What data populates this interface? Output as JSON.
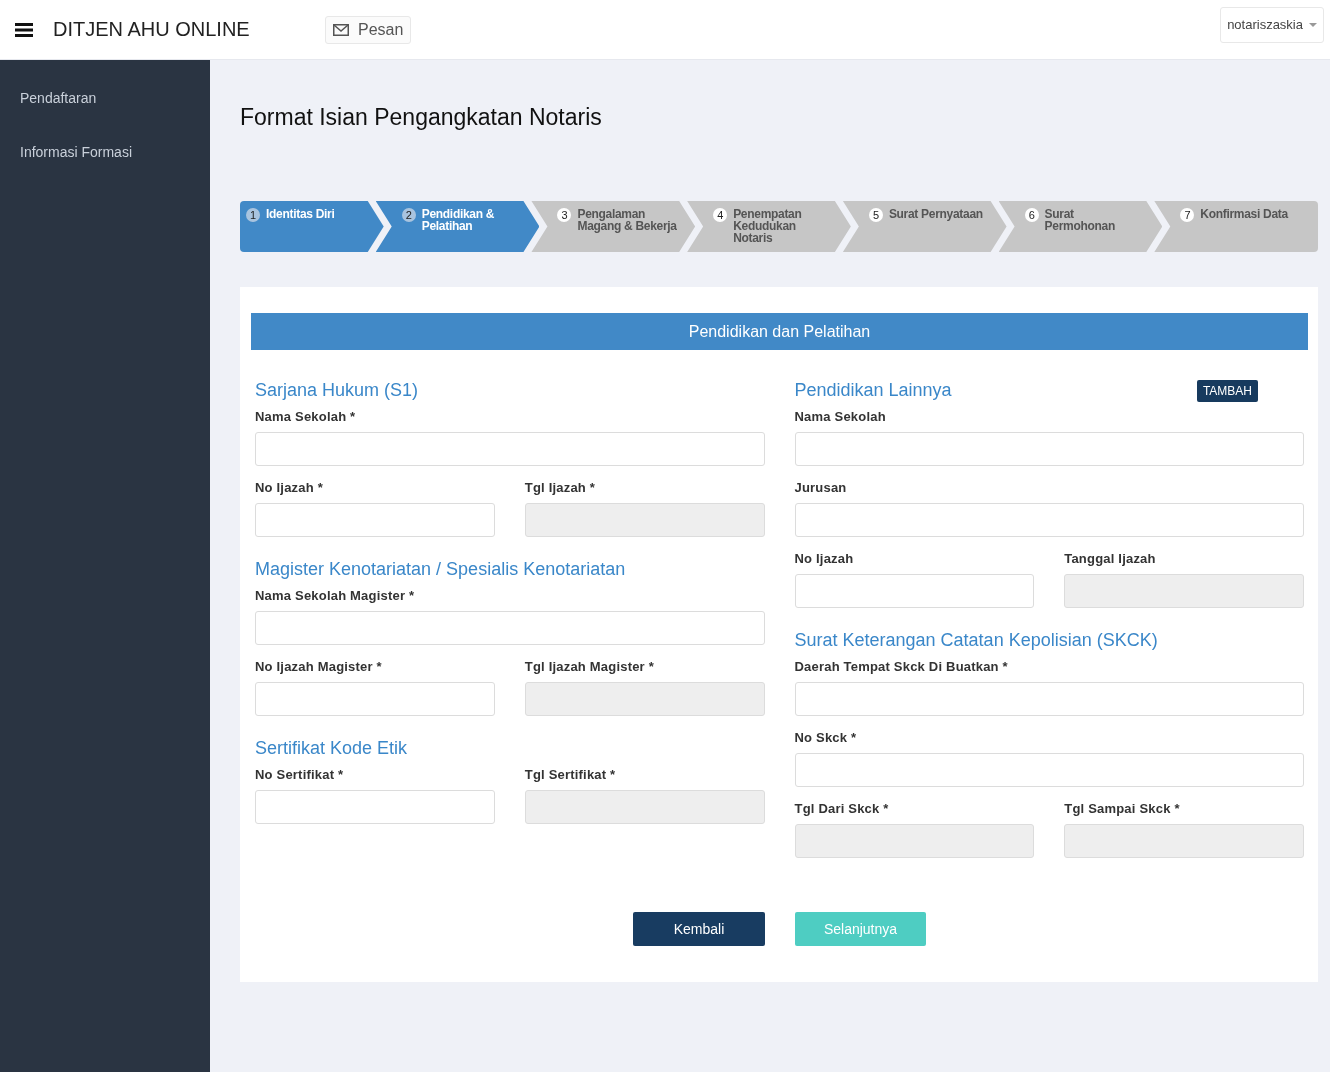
{
  "header": {
    "title": "DITJEN AHU ONLINE",
    "message_button": "Pesan",
    "user_menu": "notariszaskia"
  },
  "sidebar": {
    "items": [
      {
        "label": "Pendaftaran"
      },
      {
        "label": "Informasi Formasi"
      }
    ]
  },
  "page_title": "Format Isian Pengangkatan Notaris",
  "steps": [
    {
      "number": "1",
      "label": "Identitas Diri",
      "active": true
    },
    {
      "number": "2",
      "label": "Pendidikan & Pelatihan",
      "active": true
    },
    {
      "number": "3",
      "label": "Pengalaman Magang & Bekerja",
      "active": false
    },
    {
      "number": "4",
      "label": "Penempatan Kedudukan Notaris",
      "active": false
    },
    {
      "number": "5",
      "label": "Surat Pernyataan",
      "active": false
    },
    {
      "number": "6",
      "label": "Surat Permohonan",
      "active": false
    },
    {
      "number": "7",
      "label": "Konfirmasi Data",
      "active": false
    }
  ],
  "panel_title": "Pendidikan dan Pelatihan",
  "columns": [
    {
      "sections": [
        {
          "title": "Sarjana Hukum (S1)",
          "rows": [
            [
              {
                "label": "Nama Sekolah *",
                "disabled": false
              }
            ],
            [
              {
                "label": "No Ijazah *",
                "disabled": false
              },
              {
                "label": "Tgl Ijazah *",
                "disabled": true
              }
            ]
          ]
        },
        {
          "title": "Magister Kenotariatan / Spesialis Kenotariatan",
          "rows": [
            [
              {
                "label": "Nama Sekolah Magister *",
                "disabled": false
              }
            ],
            [
              {
                "label": "No Ijazah Magister *",
                "disabled": false
              },
              {
                "label": "Tgl Ijazah Magister *",
                "disabled": true
              }
            ]
          ]
        },
        {
          "title": "Sertifikat Kode Etik",
          "rows": [
            [
              {
                "label": "No Sertifikat *",
                "disabled": false
              },
              {
                "label": "Tgl Sertifikat *",
                "disabled": true
              }
            ]
          ]
        }
      ]
    },
    {
      "sections": [
        {
          "title": "Pendidikan Lainnya",
          "action": "TAMBAH",
          "rows": [
            [
              {
                "label": "Nama Sekolah",
                "disabled": false
              }
            ],
            [
              {
                "label": "Jurusan",
                "disabled": false
              }
            ],
            [
              {
                "label": "No Ijazah",
                "disabled": false
              },
              {
                "label": "Tanggal Ijazah",
                "disabled": true
              }
            ]
          ]
        },
        {
          "title": "Surat Keterangan Catatan Kepolisian (SKCK)",
          "rows": [
            [
              {
                "label": "Daerah Tempat Skck Di Buatkan *",
                "disabled": false
              }
            ],
            [
              {
                "label": "No Skck *",
                "disabled": false
              }
            ],
            [
              {
                "label": "Tgl Dari Skck *",
                "disabled": true
              },
              {
                "label": "Tgl Sampai Skck *",
                "disabled": true
              }
            ]
          ]
        }
      ]
    }
  ],
  "buttons": {
    "back": "Kembali",
    "next": "Selanjutnya"
  }
}
